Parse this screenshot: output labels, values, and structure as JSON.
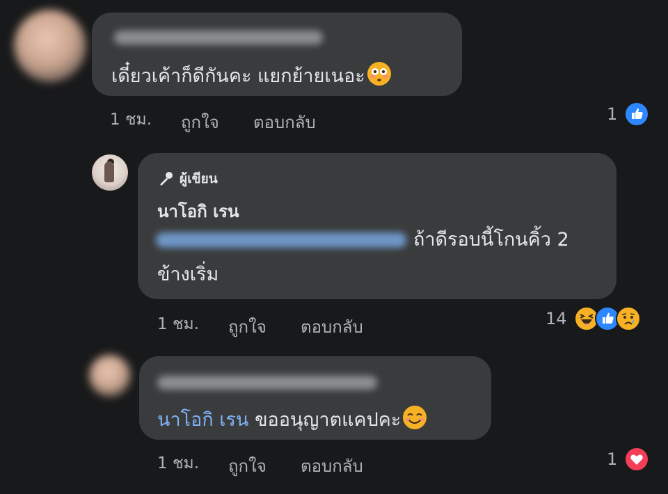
{
  "comments": [
    {
      "text": "เดี๋ยวเค้าก็ดีกันคะ แยกย้ายเนอะ",
      "time": "1 ชม.",
      "like_label": "ถูกใจ",
      "reply_label": "ตอบกลับ",
      "reaction_count": "1",
      "reaction_icons": [
        "like-icon"
      ],
      "emoji": "flushed-face-emoji"
    },
    {
      "badge_label": "ผู้เขียน",
      "author": "นาโอกิ เรน",
      "text_line1": "ถ้าดีรอบนี้โกนคิ้ว 2",
      "text_line2": "ข้างเริ่ม",
      "time": "1 ชม.",
      "like_label": "ถูกใจ",
      "reply_label": "ตอบกลับ",
      "reaction_count": "14",
      "reaction_icons": [
        "haha-icon",
        "like-icon",
        "sad-icon"
      ]
    },
    {
      "mention": "นาโอกิ เรน",
      "text": "ขออนุญาตแคปคะ",
      "time": "1 ชม.",
      "like_label": "ถูกใจ",
      "reply_label": "ตอบกลับ",
      "reaction_count": "1",
      "reaction_icons": [
        "love-icon"
      ],
      "emoji": "smiling-face-emoji"
    }
  ],
  "colors": {
    "background": "#18191a",
    "bubble": "#3a3b3c",
    "text": "#e4e6eb",
    "secondary_text": "#b0b3b8",
    "mention": "#7eb2f5",
    "like": "#2d88ff",
    "love": "#f33e58",
    "emoji_yellow": "#f7b125"
  }
}
